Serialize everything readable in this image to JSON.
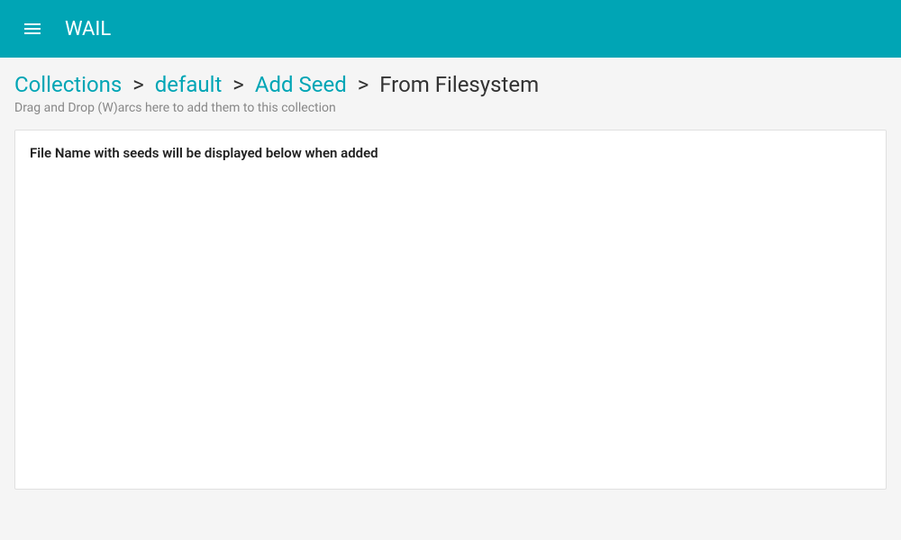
{
  "header": {
    "app_title": "WAIL"
  },
  "breadcrumb": {
    "items": [
      {
        "label": "Collections",
        "link": true
      },
      {
        "label": "default",
        "link": true
      },
      {
        "label": "Add Seed",
        "link": true
      },
      {
        "label": "From Filesystem",
        "link": false
      }
    ],
    "separator": ">"
  },
  "subtitle": "Drag and Drop (W)arcs here to add them to this collection",
  "drop_area": {
    "header": "File Name with seeds will be displayed below when added"
  }
}
